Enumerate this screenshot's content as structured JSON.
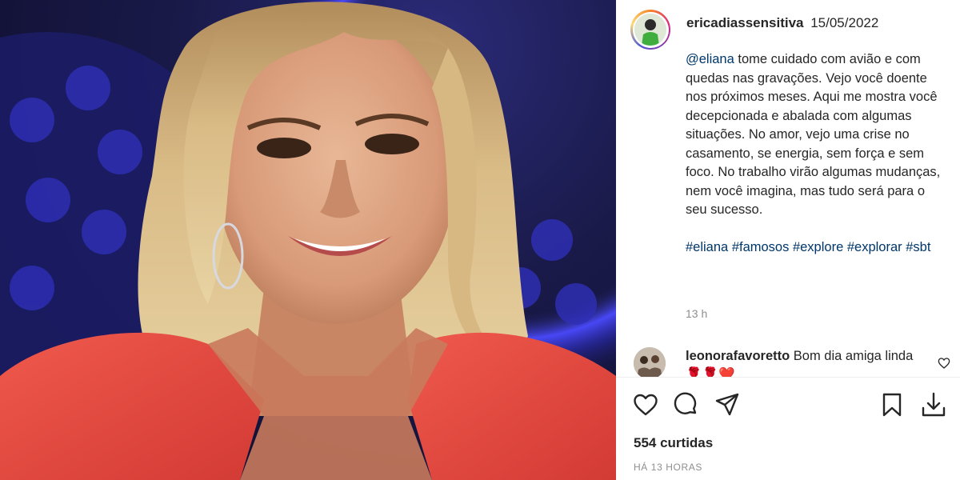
{
  "post": {
    "username": "ericadiassensitiva",
    "date": "15/05/2022",
    "caption": {
      "mention": "@eliana",
      "text": "tome cuidado com avião e com quedas nas gravações. Vejo você doente nos próximos meses. Aqui me mostra você decepcionada e abalada com algumas situações. No amor, vejo uma crise no casamento, se energia, sem força e sem foco. No trabalho virão algumas mudanças, nem você imagina, mas tudo será para o seu sucesso.",
      "hashtags": [
        "#eliana",
        "#famosos",
        "#explore",
        "#explorar",
        "#sbt"
      ]
    },
    "caption_time": "13 h"
  },
  "comment": {
    "username": "leonorafavoretto",
    "text": "Bom dia amiga linda 🌹🌹❤️"
  },
  "actions": {
    "icons": [
      "heart-icon",
      "comment-icon",
      "share-icon",
      "bookmark-icon",
      "download-icon"
    ]
  },
  "likes_label": "554 curtidas",
  "posted_ago": "HÁ 13 HORAS",
  "colors": {
    "text": "#262626",
    "secondary": "#8e8e8e",
    "link": "#00376b",
    "divider": "#efefef",
    "jacket": "#e8473f",
    "backdrop_blue": "#3b3bd0"
  }
}
